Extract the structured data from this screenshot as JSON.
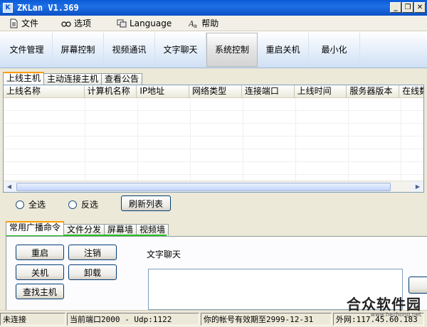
{
  "window": {
    "title": "ZKLan V1.369",
    "app_icon": "K"
  },
  "window_buttons": {
    "minimize": "_",
    "restore": "❐",
    "close": "✕"
  },
  "menu": [
    {
      "label": "文件",
      "icon": "document-icon"
    },
    {
      "label": "选项",
      "icon": "glasses-icon"
    },
    {
      "label": "Language",
      "icon": "language-icon"
    },
    {
      "label": "帮助",
      "icon": "help-icon"
    }
  ],
  "toolbar": [
    "文件管理",
    "屏幕控制",
    "视频通讯",
    "文字聊天",
    "系统控制",
    "重启关机",
    "最小化"
  ],
  "toolbar_active": "系统控制",
  "tabs_top": [
    "上线主机",
    "主动连接主机",
    "查看公告"
  ],
  "list_columns": [
    "上线名称",
    "计算机名称",
    "IP地址",
    "网络类型",
    "连接端口",
    "上线时间",
    "服务器版本",
    "在线数"
  ],
  "selection": {
    "select_all": "全选",
    "invert": "反选",
    "refresh": "刷新列表"
  },
  "tabs_bottom": [
    "常用广播命令",
    "文件分发",
    "屏幕墙",
    "视频墙"
  ],
  "commands": {
    "restart": "重启",
    "logout": "注销",
    "shutdown": "关机",
    "uninstall": "卸载",
    "find_host": "查找主机"
  },
  "chat_label": "文字聊天",
  "status": {
    "connection": "未连接",
    "port": "当前端口2000 - Udp:1122",
    "expiry": "你的帐号有效期至2999-12-31",
    "external_ip": "外网:117.45.60.183"
  },
  "watermark": {
    "main": "合众软件园",
    "sub": "www.hezhong.net"
  }
}
